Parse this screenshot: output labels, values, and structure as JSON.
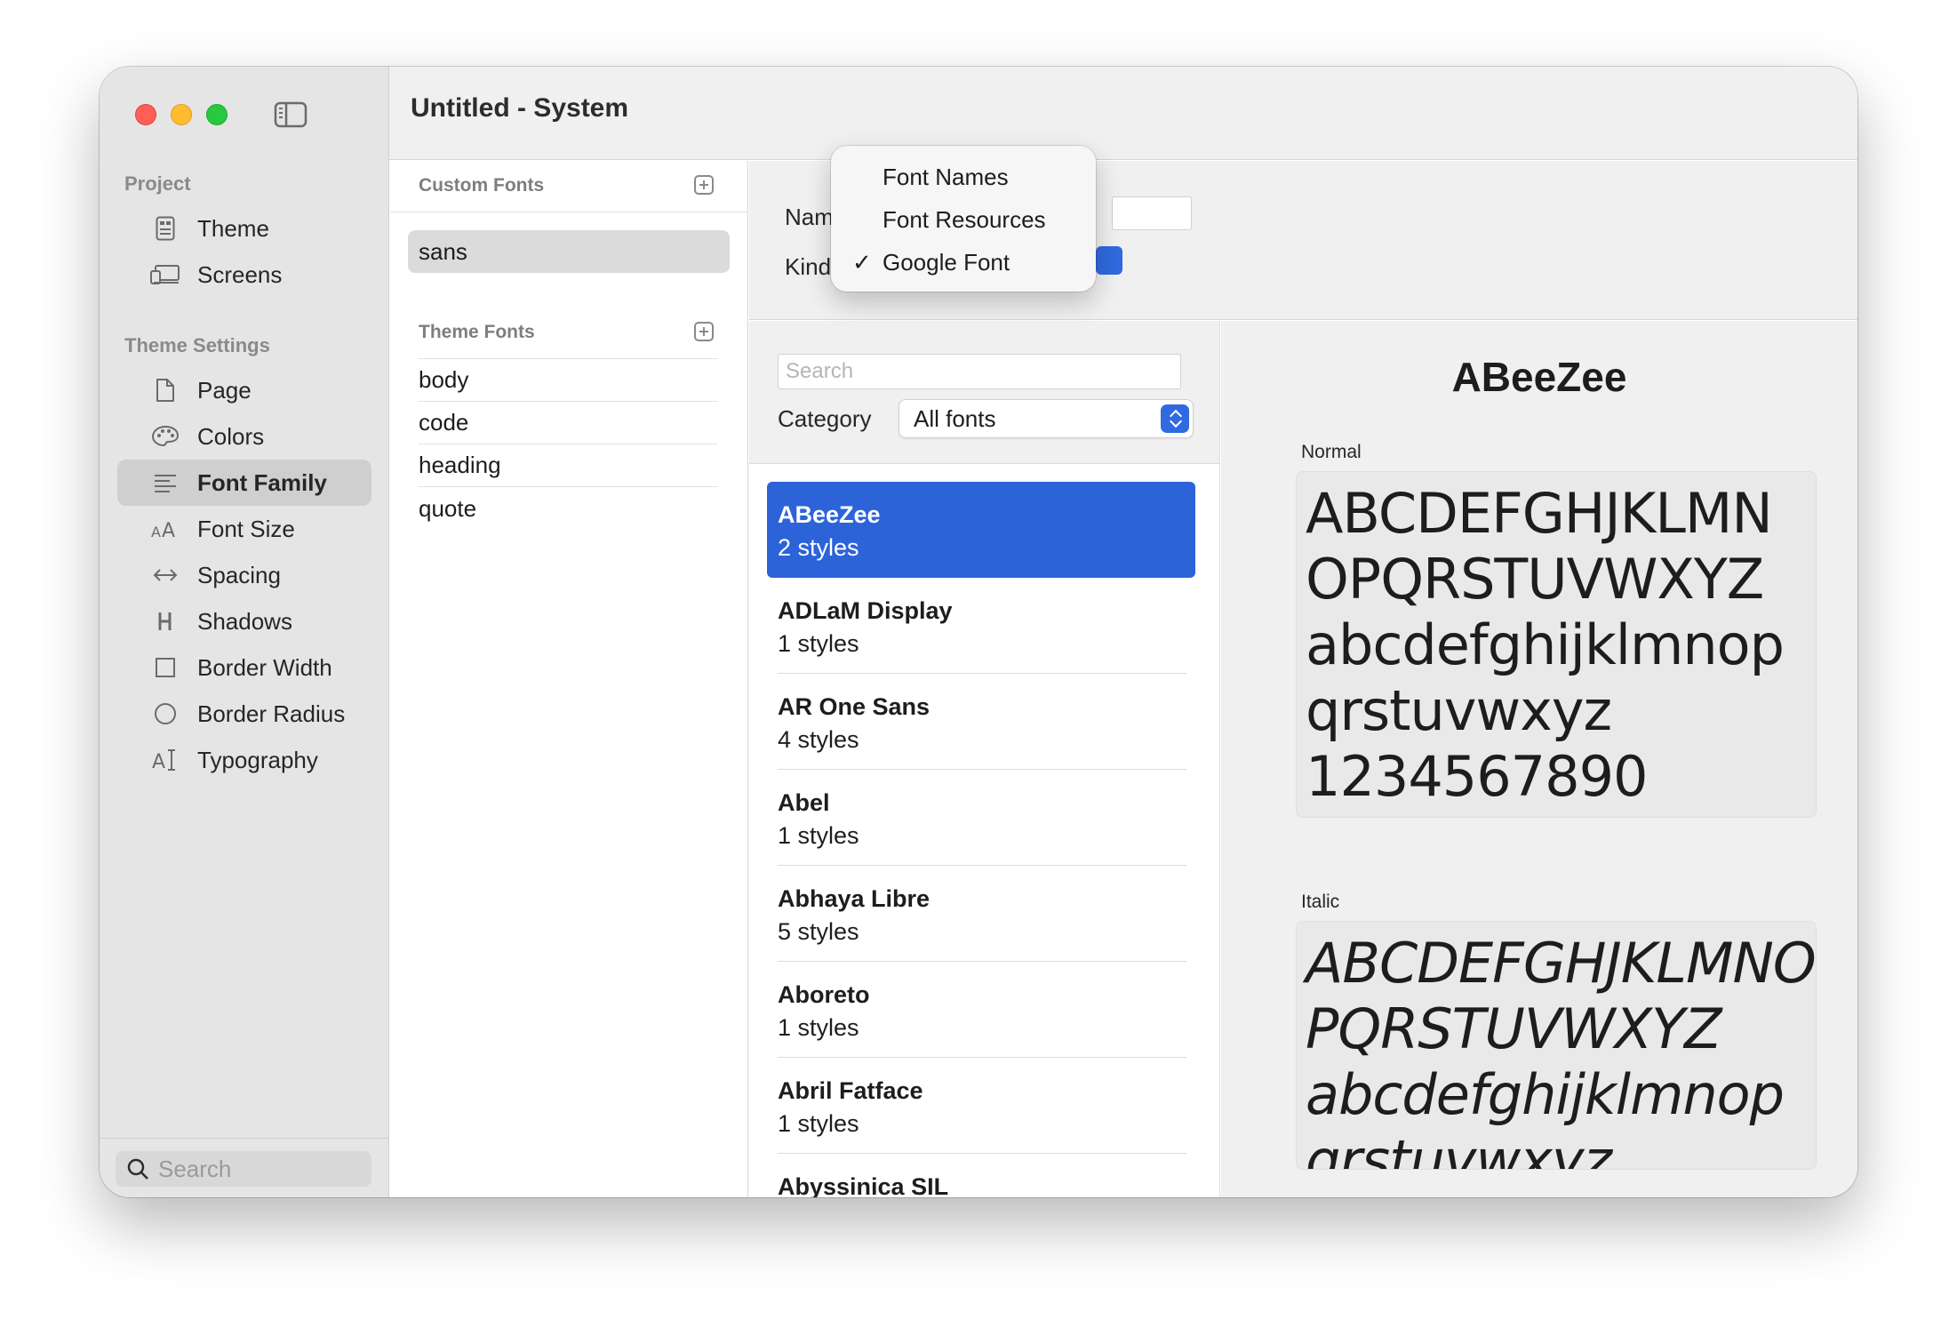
{
  "window": {
    "title": "Untitled - System"
  },
  "sidebar": {
    "project_header": "Project",
    "project_items": [
      {
        "label": "Theme",
        "icon": "theme-icon"
      },
      {
        "label": "Screens",
        "icon": "screens-icon"
      }
    ],
    "theme_settings_header": "Theme Settings",
    "theme_items": [
      {
        "label": "Page",
        "icon": "page-icon"
      },
      {
        "label": "Colors",
        "icon": "palette-icon"
      },
      {
        "label": "Font Family",
        "icon": "text-lines-icon",
        "selected": true
      },
      {
        "label": "Font Size",
        "icon": "font-size-icon"
      },
      {
        "label": "Spacing",
        "icon": "spacing-icon"
      },
      {
        "label": "Shadows",
        "icon": "shadows-icon"
      },
      {
        "label": "Border Width",
        "icon": "square-icon"
      },
      {
        "label": "Border Radius",
        "icon": "circle-icon"
      },
      {
        "label": "Typography",
        "icon": "typography-icon"
      }
    ],
    "search_placeholder": "Search"
  },
  "fonts_panel": {
    "custom_header": "Custom Fonts",
    "custom_fonts": [
      "sans"
    ],
    "theme_header": "Theme Fonts",
    "theme_fonts": [
      "body",
      "code",
      "heading",
      "quote"
    ]
  },
  "detail": {
    "name_label": "Nam",
    "kind_label": "Kind"
  },
  "kind_menu": {
    "items": [
      {
        "label": "Font Names",
        "checked": false
      },
      {
        "label": "Font Resources",
        "checked": false
      },
      {
        "label": "Google Font",
        "checked": true
      }
    ],
    "check_glyph": "✓"
  },
  "google_fonts": {
    "search_placeholder": "Search",
    "category_label": "Category",
    "category_value": "All fonts",
    "items": [
      {
        "name": "ABeeZee",
        "styles": "2 styles",
        "selected": true
      },
      {
        "name": "ADLaM Display",
        "styles": "1 styles"
      },
      {
        "name": "AR One Sans",
        "styles": "4 styles"
      },
      {
        "name": "Abel",
        "styles": "1 styles"
      },
      {
        "name": "Abhaya Libre",
        "styles": "5 styles"
      },
      {
        "name": "Aboreto",
        "styles": "1 styles"
      },
      {
        "name": "Abril Fatface",
        "styles": "1 styles"
      },
      {
        "name": "Abyssinica SIL",
        "styles": ""
      }
    ]
  },
  "preview": {
    "font_name": "ABeeZee",
    "normal_label": "Normal",
    "normal_lines": [
      "ABCDEFGHJKLMN",
      "OPQRSTUVWXYZ",
      "abcdefghijklmnop",
      "qrstuvwxyz",
      "1234567890"
    ],
    "italic_label": "Italic",
    "italic_lines": [
      "ABCDEFGHJKLMNO",
      "PQRSTUVWXYZ",
      "abcdefghijklmnop",
      "qrstuvwxyz"
    ]
  },
  "colors": {
    "accent": "#2d63d8",
    "sidebar_bg": "#e6e5e5",
    "selection_gray": "#d0cfcf"
  }
}
